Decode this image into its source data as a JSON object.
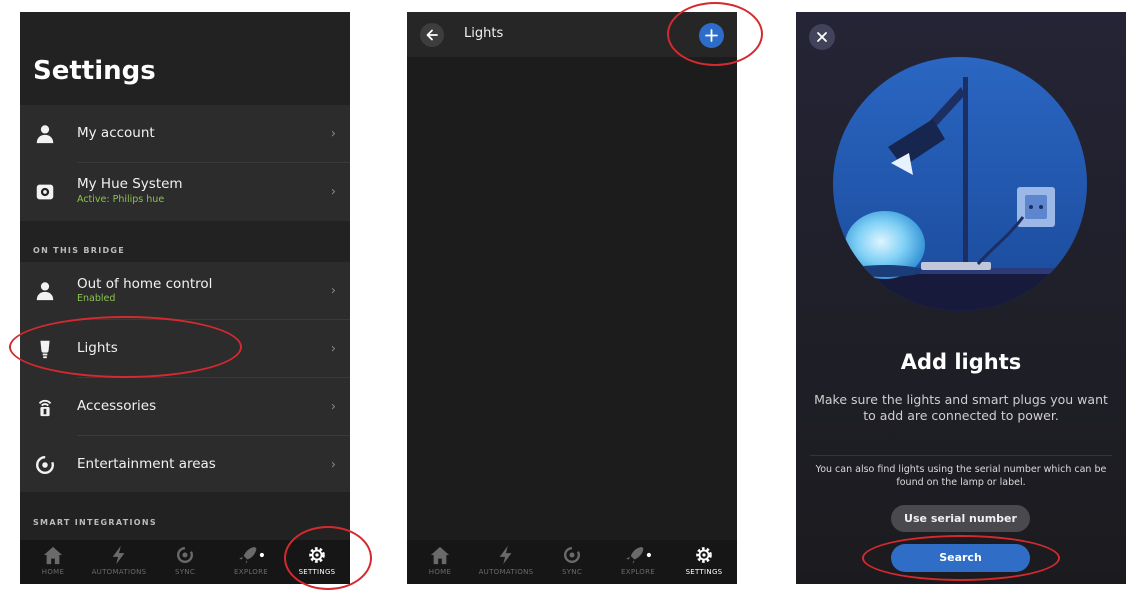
{
  "panel1": {
    "title": "Settings",
    "items": [
      {
        "label": "My account",
        "icon": "person-icon"
      },
      {
        "label": "My Hue System",
        "sub": "Active: Philips hue",
        "icon": "bridge-icon"
      },
      {
        "label": "Out of home control",
        "sub": "Enabled",
        "icon": "person-icon"
      },
      {
        "label": "Lights",
        "icon": "bulb-icon"
      },
      {
        "label": "Accessories",
        "icon": "switch-icon"
      },
      {
        "label": "Entertainment areas",
        "icon": "entertainment-icon"
      }
    ],
    "section_bridge": "ON THIS BRIDGE",
    "section_integrations": "SMART INTEGRATIONS",
    "chevron": "›"
  },
  "nav": [
    {
      "label": "HOME",
      "icon": "home-icon"
    },
    {
      "label": "AUTOMATIONS",
      "icon": "bolt-icon"
    },
    {
      "label": "SYNC",
      "icon": "sync-icon"
    },
    {
      "label": "EXPLORE",
      "icon": "rocket-icon"
    },
    {
      "label": "SETTINGS",
      "icon": "gear-icon"
    }
  ],
  "panel2": {
    "title": "Lights",
    "back_glyph": "←",
    "add_glyph": "+"
  },
  "panel3": {
    "close_glyph": "✕",
    "title": "Add lights",
    "description": "Make sure the lights and smart plugs you want to add are connected to power.",
    "note": "You can also find lights using the serial number which can be found on the lamp or label.",
    "serial_button": "Use serial number",
    "search_button": "Search"
  },
  "colors": {
    "accent_blue": "#2d6cc9",
    "status_green": "#8bc34a",
    "callout_red": "#d42a2f",
    "background": "#222222"
  }
}
